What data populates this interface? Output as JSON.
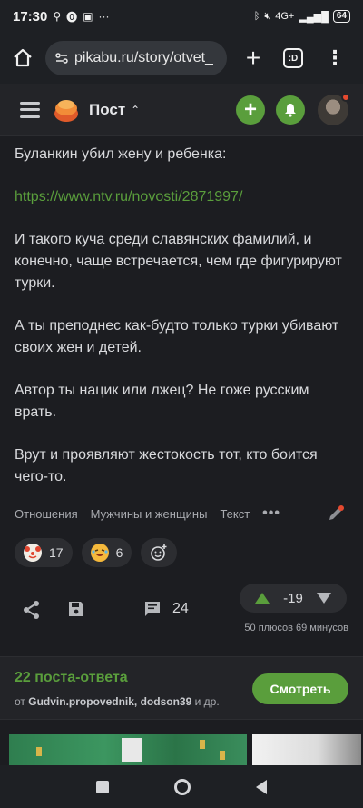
{
  "status_bar": {
    "time": "17:30",
    "battery": "64",
    "network": "4G+"
  },
  "browser": {
    "url": "pikabu.ru/story/otvet_",
    "tabs_label": ":D"
  },
  "header": {
    "title": "Пост"
  },
  "post": {
    "paragraphs": [
      "Буланкин убил жену и ребенка:",
      "https://www.ntv.ru/novosti/2871997/",
      "И такого куча среди славянских фамилий, и конечно, чаще встречается, чем где фигурируют турки.",
      "А ты преподнес как-будто только турки убивают своих жен и детей.",
      "Автор ты нацик или лжец? Не гоже русским врать.",
      "Врут и проявляют жестокость тот, кто боится чего-то."
    ],
    "tags": [
      "Отношения",
      "Мужчины и женщины",
      "Текст"
    ],
    "tags_more": "•••",
    "reactions": [
      {
        "emoji": "clown",
        "count": "17"
      },
      {
        "emoji": "laughing",
        "count": "6"
      }
    ],
    "comments_count": "24",
    "rating": "-19",
    "votes_info": "50 плюсов 69 минусов"
  },
  "answers": {
    "title": "22 поста-ответа",
    "from_label": "от",
    "authors": "Gudvin.propovednik, dodson39",
    "suffix": "и др.",
    "button": "Смотреть"
  },
  "colors": {
    "accent": "#5a9e3c",
    "background": "#1c1d21"
  }
}
